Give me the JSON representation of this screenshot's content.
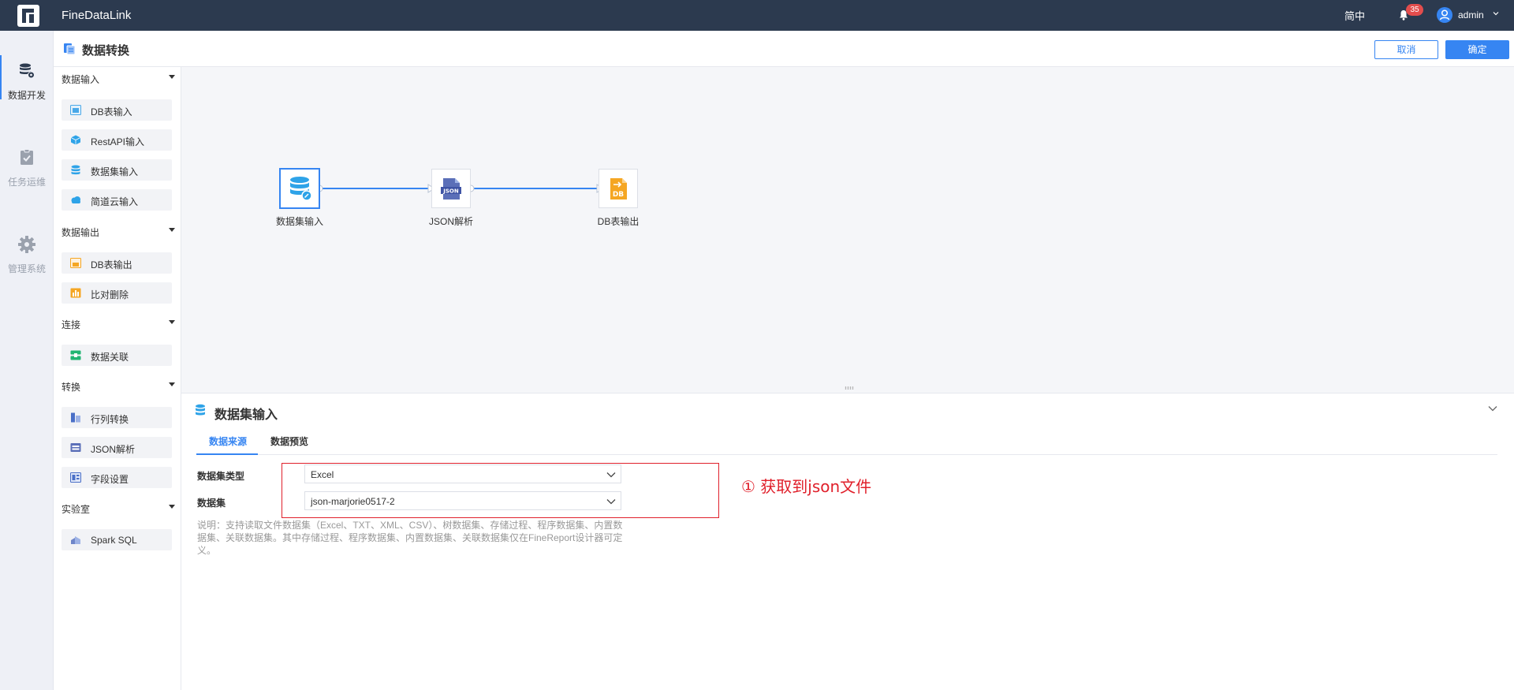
{
  "topbar": {
    "app_title": "FineDataLink",
    "language": "简中",
    "notification_count": "35",
    "user_name": "admin"
  },
  "leftnav": {
    "items": [
      {
        "label": "数据开发",
        "icon": "database-gear-icon",
        "active": true
      },
      {
        "label": "任务运维",
        "icon": "clipboard-check-icon",
        "active": false
      },
      {
        "label": "管理系统",
        "icon": "gear-icon",
        "active": false
      }
    ]
  },
  "header": {
    "title": "数据转换",
    "cancel_label": "取消",
    "confirm_label": "确定"
  },
  "palette": {
    "groups": [
      {
        "title": "数据输入",
        "items": [
          "DB表输入",
          "RestAPI输入",
          "数据集输入",
          "简道云输入"
        ]
      },
      {
        "title": "数据输出",
        "items": [
          "DB表输出",
          "比对删除"
        ]
      },
      {
        "title": "连接",
        "items": [
          "数据关联"
        ]
      },
      {
        "title": "转换",
        "items": [
          "行列转换",
          "JSON解析",
          "字段设置"
        ]
      },
      {
        "title": "实验室",
        "items": [
          "Spark SQL"
        ]
      }
    ]
  },
  "canvas": {
    "nodes": [
      {
        "label": "数据集输入",
        "icon": "dataset-icon",
        "selected": true
      },
      {
        "label": "JSON解析",
        "icon": "json-file-icon",
        "selected": false
      },
      {
        "label": "DB表输出",
        "icon": "db-output-icon",
        "selected": false
      }
    ]
  },
  "panel": {
    "title": "数据集输入",
    "tabs": [
      "数据来源",
      "数据预览"
    ],
    "active_tab": "数据来源",
    "fields": [
      {
        "label": "数据集类型",
        "value": "Excel"
      },
      {
        "label": "数据集",
        "value": "json-marjorie0517-2"
      }
    ],
    "note": "说明：支持读取文件数据集（Excel、TXT、XML、CSV）、树数据集、存储过程、程序数据集、内置数据集、关联数据集。其中存储过程、程序数据集、内置数据集、关联数据集仅在FineReport设计器可定义。",
    "annotation": "① 获取到json文件"
  },
  "colors": {
    "topbar_bg": "#2c3a4f",
    "accent": "#3685f2",
    "annotation_red": "#e0202b",
    "badge_red": "#e34d4d",
    "canvas_bg": "#f5f6f9"
  }
}
